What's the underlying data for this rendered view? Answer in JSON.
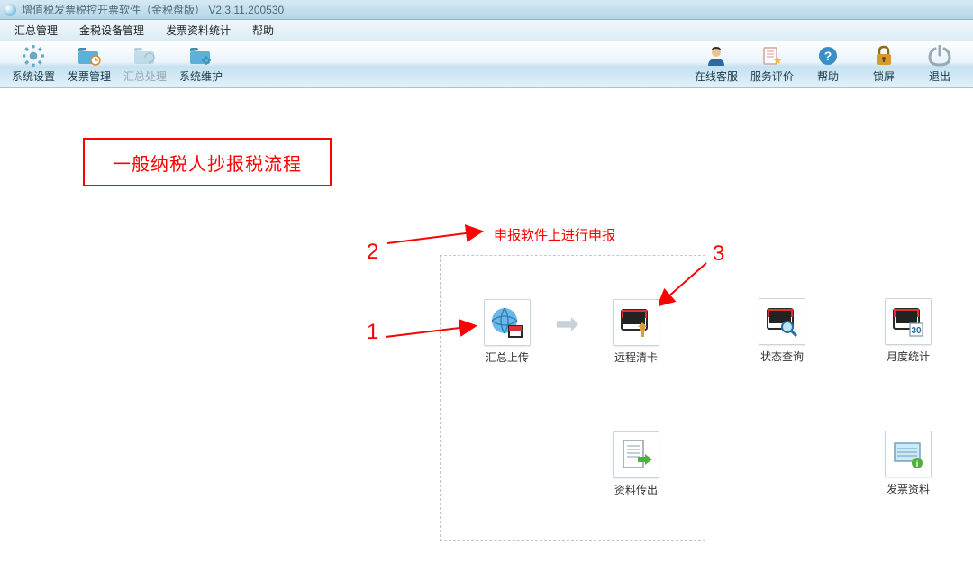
{
  "titlebar": {
    "title": "增值税发票税控开票软件（金税盘版） V2.3.11.200530"
  },
  "menubar": {
    "items": [
      {
        "label": "汇总管理"
      },
      {
        "label": "金税设备管理"
      },
      {
        "label": "发票资料统计"
      },
      {
        "label": "帮助"
      }
    ]
  },
  "toolbar": {
    "left": [
      {
        "name": "system-settings-button",
        "label": "系统设置",
        "icon": "gear-icon"
      },
      {
        "name": "invoice-manage-button",
        "label": "发票管理",
        "icon": "folder-clock-icon"
      },
      {
        "name": "summary-process-button",
        "label": "汇总处理",
        "icon": "folder-cycle-icon",
        "disabled": true
      },
      {
        "name": "system-maintain-button",
        "label": "系统维护",
        "icon": "folder-gear-icon"
      }
    ],
    "right": [
      {
        "name": "online-service-button",
        "label": "在线客服",
        "icon": "person-icon"
      },
      {
        "name": "service-rating-button",
        "label": "服务评价",
        "icon": "star-paper-icon"
      },
      {
        "name": "help-button",
        "label": "帮助",
        "icon": "question-icon"
      },
      {
        "name": "lock-button",
        "label": "锁屏",
        "icon": "lock-icon"
      },
      {
        "name": "exit-button",
        "label": "退出",
        "icon": "power-icon"
      }
    ]
  },
  "annotations": {
    "box_title": "一般纳税人抄报税流程",
    "num1": "1",
    "num2": "2",
    "num3": "3",
    "note": "申报软件上进行申报"
  },
  "flowPanel": {
    "items": [
      {
        "name": "summary-upload-button",
        "label": "汇总上传",
        "icon": "globe-upload-icon"
      },
      {
        "name": "remote-clear-button",
        "label": "远程清卡",
        "icon": "clear-card-icon"
      },
      {
        "name": "data-export-button",
        "label": "资料传出",
        "icon": "doc-export-icon"
      }
    ]
  },
  "rightItems": [
    {
      "name": "status-query-button",
      "label": "状态查询",
      "icon": "monitor-magnify-icon"
    },
    {
      "name": "monthly-stats-button",
      "label": "月度统计",
      "icon": "calendar-30-icon"
    },
    {
      "name": "invoice-data-button",
      "label": "发票资料",
      "icon": "doc-info-icon"
    }
  ]
}
